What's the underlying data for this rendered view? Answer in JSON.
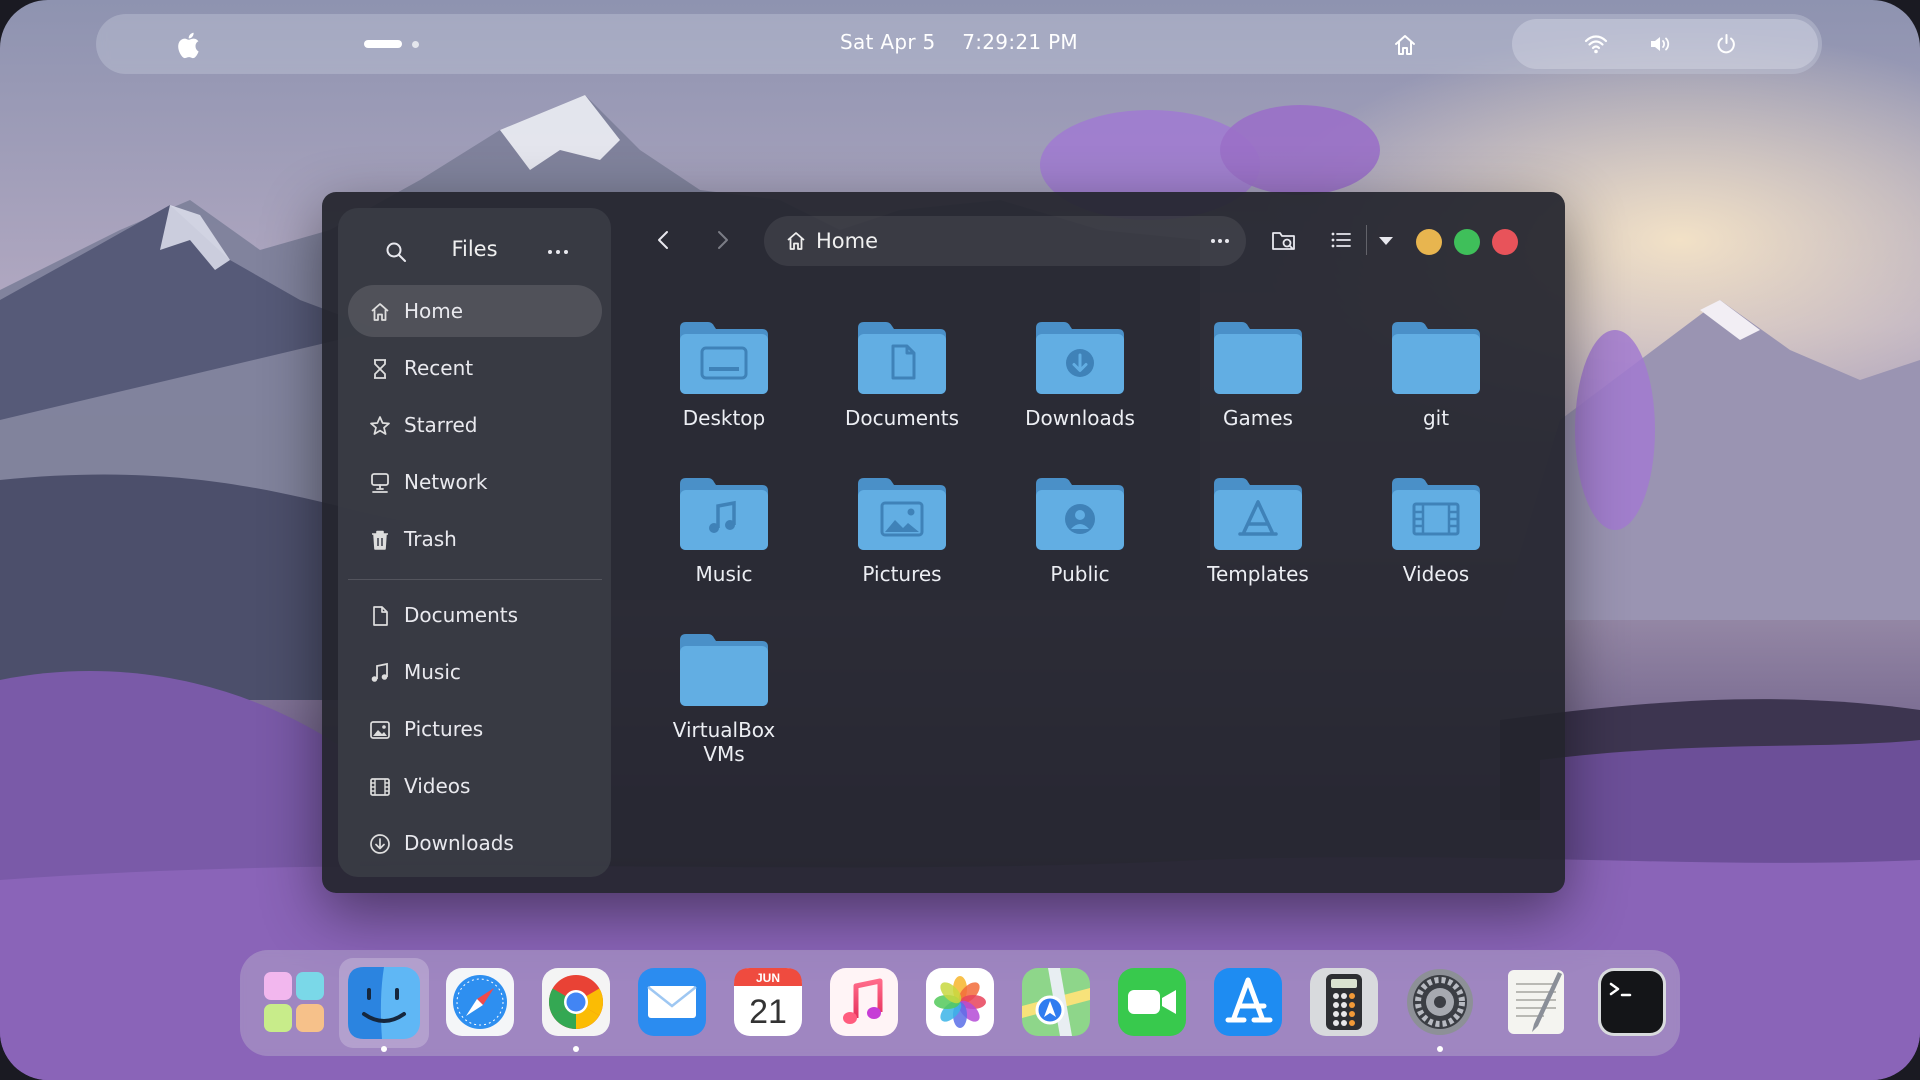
{
  "topbar": {
    "date": "Sat Apr 5",
    "time": "7:29:21 PM",
    "icons": [
      "apple-icon",
      "home-icon",
      "wifi-icon",
      "volume-icon",
      "power-icon"
    ]
  },
  "files_window": {
    "sidebar": {
      "title": "Files",
      "places": [
        {
          "label": "Home",
          "icon": "home-icon",
          "active": true
        },
        {
          "label": "Recent",
          "icon": "hourglass-icon"
        },
        {
          "label": "Starred",
          "icon": "star-icon"
        },
        {
          "label": "Network",
          "icon": "network-icon"
        },
        {
          "label": "Trash",
          "icon": "trash-icon"
        }
      ],
      "bookmarks": [
        {
          "label": "Documents",
          "icon": "document-icon"
        },
        {
          "label": "Music",
          "icon": "music-note-icon"
        },
        {
          "label": "Pictures",
          "icon": "image-icon"
        },
        {
          "label": "Videos",
          "icon": "film-icon"
        },
        {
          "label": "Downloads",
          "icon": "download-icon"
        }
      ]
    },
    "path": {
      "label": "Home"
    },
    "folders": [
      {
        "label": "Desktop",
        "icon": "desktop-icon"
      },
      {
        "label": "Documents",
        "icon": "document-icon"
      },
      {
        "label": "Downloads",
        "icon": "download-icon"
      },
      {
        "label": "Games",
        "icon": "none"
      },
      {
        "label": "git",
        "icon": "none"
      },
      {
        "label": "Music",
        "icon": "music-note-icon"
      },
      {
        "label": "Pictures",
        "icon": "image-icon"
      },
      {
        "label": "Public",
        "icon": "person-icon"
      },
      {
        "label": "Templates",
        "icon": "template-icon"
      },
      {
        "label": "Videos",
        "icon": "film-icon"
      },
      {
        "label": "VirtualBox VMs",
        "icon": "none"
      }
    ],
    "colors": {
      "folder": "#62aee3",
      "folder_dark": "#4a90c8",
      "minimize": "#e8b54f",
      "maximize": "#3fbf5a",
      "close": "#e8535a"
    }
  },
  "dock": {
    "calendar_month": "JUN",
    "calendar_day": "21",
    "apps": [
      {
        "name": "launchpad",
        "running": false
      },
      {
        "name": "finder",
        "running": true
      },
      {
        "name": "safari",
        "running": false
      },
      {
        "name": "chrome",
        "running": true
      },
      {
        "name": "mail",
        "running": false
      },
      {
        "name": "calendar",
        "running": false
      },
      {
        "name": "music",
        "running": false
      },
      {
        "name": "photos",
        "running": false
      },
      {
        "name": "maps",
        "running": false
      },
      {
        "name": "facetime",
        "running": false
      },
      {
        "name": "app-store",
        "running": false
      },
      {
        "name": "calculator",
        "running": false
      },
      {
        "name": "system-settings",
        "running": true
      },
      {
        "name": "textedit",
        "running": false
      },
      {
        "name": "terminal",
        "running": false
      }
    ]
  }
}
